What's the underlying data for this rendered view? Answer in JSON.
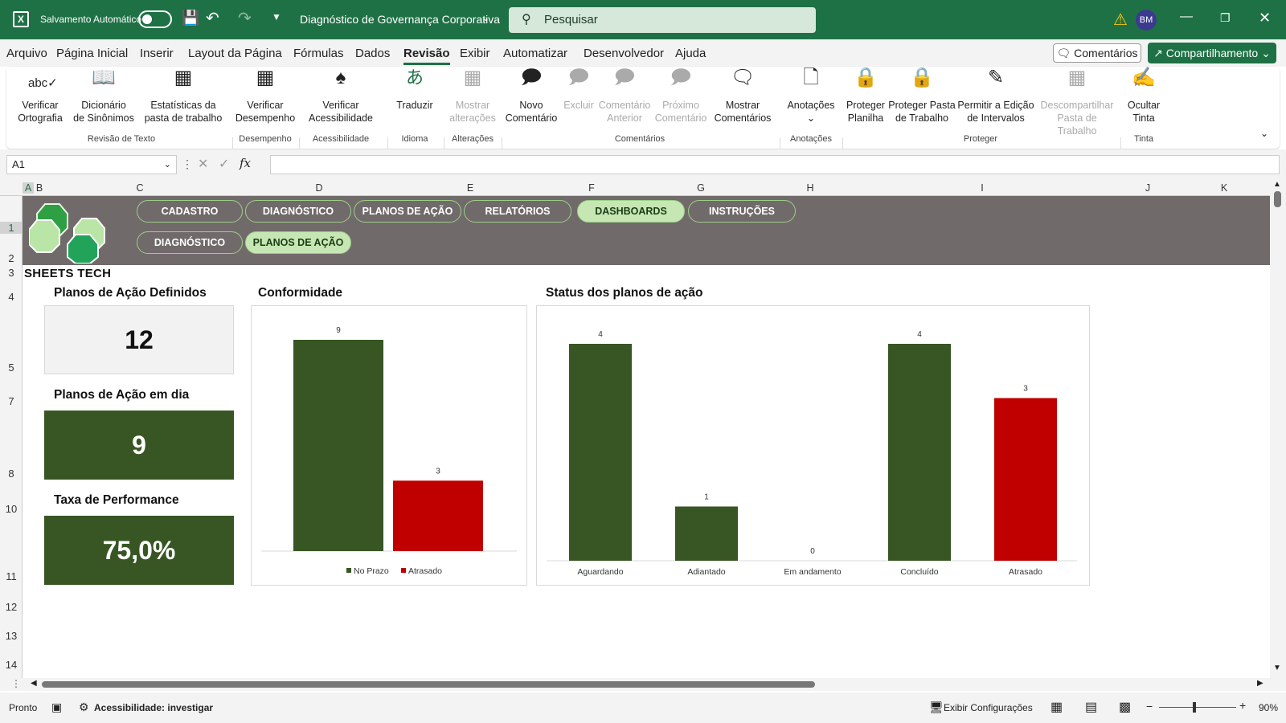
{
  "titlebar": {
    "autosave_label": "Salvamento Automático",
    "doc_title": "Diagnóstico de Governança Corporativa",
    "search_placeholder": "Pesquisar",
    "avatar": "BM"
  },
  "menu": {
    "items": [
      "Arquivo",
      "Página Inicial",
      "Inserir",
      "Layout da Página",
      "Fórmulas",
      "Dados",
      "Revisão",
      "Exibir",
      "Automatizar",
      "Desenvolvedor",
      "Ajuda"
    ],
    "active": "Revisão",
    "comments": "Comentários",
    "share": "Compartilhamento"
  },
  "ribbon": {
    "spelling": "Verificar\nOrtografia",
    "thesaurus": "Dicionário\nde Sinônimos",
    "stats": "Estatísticas da\npasta de trabalho",
    "performance": "Verificar\nDesempenho",
    "accessibility": "Verificar\nAcessibilidade",
    "translate": "Traduzir",
    "show_changes": "Mostrar\nalterações",
    "new_comment": "Novo\nComentário",
    "delete": "Excluir",
    "prev_comment": "Comentário\nAnterior",
    "next_comment": "Próximo\nComentário",
    "show_comments": "Mostrar\nComentários",
    "notes": "Anotações",
    "protect_sheet": "Proteger\nPlanilha",
    "protect_workbook": "Proteger Pasta\nde Trabalho",
    "allow_edit": "Permitir a Edição\nde Intervalos",
    "unshare": "Descompartilhar\nPasta de Trabalho",
    "hide_ink": "Ocultar\nTinta",
    "groups": {
      "proofing": "Revisão de Texto",
      "performance": "Desempenho",
      "accessibility": "Acessibilidade",
      "language": "Idioma",
      "changes": "Alterações",
      "comments": "Comentários",
      "notes": "Anotações",
      "protect": "Proteger",
      "ink": "Tinta"
    }
  },
  "formula": {
    "namebox": "A1",
    "value": ""
  },
  "columns": [
    "A",
    "B",
    "C",
    "D",
    "E",
    "F",
    "G",
    "H",
    "I",
    "J",
    "K"
  ],
  "rows": [
    "1",
    "2",
    "3",
    "4",
    "5",
    "7",
    "8",
    "10",
    "11",
    "12",
    "13",
    "14"
  ],
  "dashboard": {
    "brand": "SHEETS TECH",
    "nav_top": [
      "CADASTRO",
      "DIAGNÓSTICO",
      "PLANOS DE AÇÃO",
      "RELATÓRIOS",
      "DASHBOARDS",
      "INSTRUÇÕES"
    ],
    "nav_sub": [
      "DIAGNÓSTICO",
      "PLANOS DE AÇÃO"
    ],
    "kpi1_title": "Planos de Ação Definidos",
    "kpi1_value": "12",
    "kpi2_title": "Planos de Ação em dia",
    "kpi2_value": "9",
    "kpi3_title": "Taxa de Performance",
    "kpi3_value": "75,0%",
    "chart1_title": "Conformidade",
    "chart2_title": "Status dos planos de ação"
  },
  "colors": {
    "excel_green": "#1e7145",
    "dark_green": "#375623",
    "red": "#c00000",
    "banner": "#716a6a"
  },
  "chart_data": [
    {
      "type": "bar",
      "title": "Conformidade",
      "categories": [
        "No Prazo",
        "Atrasado"
      ],
      "values": [
        9,
        3
      ],
      "legend": "bottom",
      "ylim": [
        0,
        9
      ]
    },
    {
      "type": "bar",
      "title": "Status dos planos de ação",
      "categories": [
        "Aguardando",
        "Adiantado",
        "Em andamento",
        "Concluído",
        "Atrasado"
      ],
      "values": [
        4,
        1,
        0,
        4,
        3
      ],
      "ylim": [
        0,
        4
      ]
    }
  ],
  "status": {
    "ready": "Pronto",
    "accessibility": "Acessibilidade: investigar",
    "display": "Exibir Configurações",
    "zoom": "90%"
  }
}
